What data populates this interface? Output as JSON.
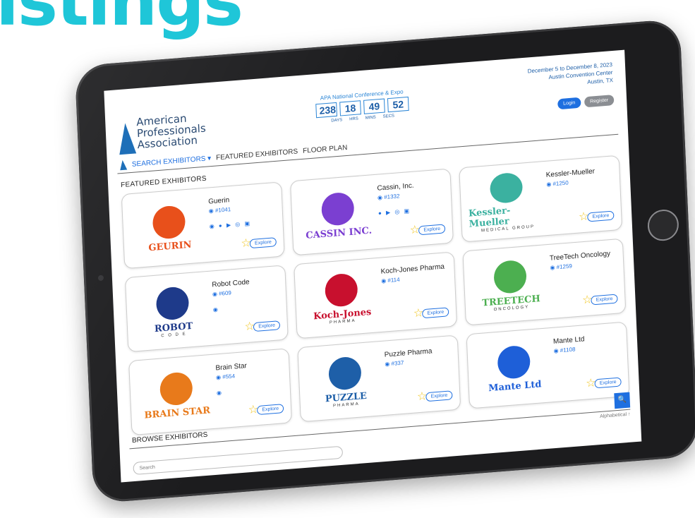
{
  "headline": "istings",
  "header": {
    "logo_lines": [
      "American",
      "Professionals",
      "Association"
    ],
    "countdown_title": "APA National Conference & Expo",
    "countdown": [
      {
        "value": "238",
        "label": "DAYS"
      },
      {
        "value": "18",
        "label": "HRS"
      },
      {
        "value": "49",
        "label": "MINS"
      },
      {
        "value": "52",
        "label": "SECS"
      }
    ],
    "event_dates": "December 5 to December 8, 2023",
    "event_venue": "Austin Convention Center",
    "event_city": "Austin, TX",
    "login_label": "Login",
    "register_label": "Register"
  },
  "nav": {
    "items": [
      {
        "label": "SEARCH EXHIBITORS ▾",
        "active": true
      },
      {
        "label": "FEATURED EXHIBITORS",
        "active": false
      },
      {
        "label": "FLOOR PLAN",
        "active": false
      }
    ]
  },
  "featured": {
    "title": "FEATURED EXHIBITORS",
    "explore_label": "Explore",
    "cards": [
      {
        "name": "Guerin",
        "booth": "#1041",
        "logo_word": "GEURIN",
        "logo_sub": "",
        "logo_color": "#e8501b",
        "social": "◉ ● ▶ ◎ ▣"
      },
      {
        "name": "Cassin, Inc.",
        "booth": "#1332",
        "logo_word": "CASSIN INC.",
        "logo_sub": "",
        "logo_color": "#7b3fd1",
        "social": "● ▶ ◎ ▣"
      },
      {
        "name": "Kessler-Mueller",
        "booth": "#1250",
        "logo_word": "Kessler-Mueller",
        "logo_sub": "MEDICAL GROUP",
        "logo_color": "#3bb1a0",
        "social": ""
      },
      {
        "name": "Robot Code",
        "booth": "#609",
        "logo_word": "ROBOT",
        "logo_sub": "C O D E",
        "logo_color": "#1e3a8a",
        "social": "◉"
      },
      {
        "name": "Koch-Jones Pharma",
        "booth": "#114",
        "logo_word": "Koch-Jones",
        "logo_sub": "PHARMA",
        "logo_color": "#c8102e",
        "social": ""
      },
      {
        "name": "TreeTech Oncology",
        "booth": "#1259",
        "logo_word": "TREETECH",
        "logo_sub": "ONCOLOGY",
        "logo_color": "#4caf50",
        "social": ""
      },
      {
        "name": "Brain Star",
        "booth": "#554",
        "logo_word": "BRAIN STAR",
        "logo_sub": "",
        "logo_color": "#e87a1b",
        "social": "◉"
      },
      {
        "name": "Puzzle Pharma",
        "booth": "#337",
        "logo_word": "PUZZLE",
        "logo_sub": "PHARMA",
        "logo_color": "#1e5fa8",
        "social": ""
      },
      {
        "name": "Mante Ltd",
        "booth": "#1108",
        "logo_word": "Mante Ltd",
        "logo_sub": "",
        "logo_color": "#1e5fd8",
        "social": ""
      }
    ]
  },
  "browse": {
    "title": "BROWSE EXHIBITORS",
    "sort_label": "Alphabetical ↑",
    "search_placeholder": "Search",
    "search_icon": "🔍"
  },
  "colors": {
    "accent": "#1e6fe0",
    "headline": "#1fc6d8",
    "brand": "#1e6fb8"
  }
}
